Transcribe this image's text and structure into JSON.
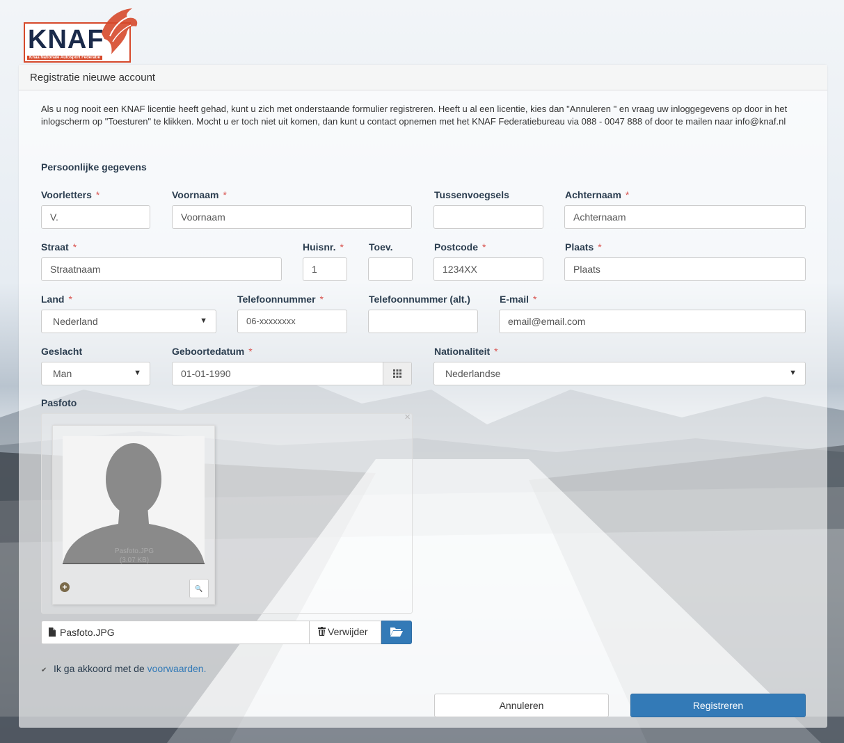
{
  "logo": {
    "text": "KNAF",
    "subtitle": "Knaa Nationale Autosport Federatie"
  },
  "panel": {
    "title": "Registratie nieuwe account",
    "intro": "Als u nog nooit een KNAF licentie heeft gehad, kunt u zich met onderstaande formulier registreren. Heeft u al een licentie, kies dan \"Annuleren \" en vraag uw inloggegevens op door in het inlogscherm op \"Toesturen\" te klikken. Mocht u er toch niet uit komen, dan kunt u contact opnemen met het KNAF Federatiebureau via 088 - 0047 888 of door te mailen naar info@knaf.nl",
    "section_title": "Persoonlijke gegevens"
  },
  "form": {
    "required_mark": "*",
    "voorletters": {
      "label": "Voorletters",
      "value": "V."
    },
    "voornaam": {
      "label": "Voornaam",
      "value": "Voornaam"
    },
    "tussenvoegsels": {
      "label": "Tussenvoegsels",
      "value": ""
    },
    "achternaam": {
      "label": "Achternaam",
      "value": "Achternaam"
    },
    "straat": {
      "label": "Straat",
      "value": "Straatnaam"
    },
    "huisnr": {
      "label": "Huisnr.",
      "value": "1"
    },
    "toev": {
      "label": "Toev.",
      "value": ""
    },
    "postcode": {
      "label": "Postcode",
      "value": "1234XX"
    },
    "plaats": {
      "label": "Plaats",
      "value": "Plaats"
    },
    "land": {
      "label": "Land",
      "value": "Nederland"
    },
    "telefoon": {
      "label": "Telefoonnummer",
      "value": "06-xxxxxxxx"
    },
    "telefoon_alt": {
      "label": "Telefoonnummer (alt.)",
      "value": ""
    },
    "email": {
      "label": "E-mail",
      "value": "email@email.com"
    },
    "geslacht": {
      "label": "Geslacht",
      "value": "Man"
    },
    "geboortedatum": {
      "label": "Geboortedatum",
      "value": "01-01-1990"
    },
    "nationaliteit": {
      "label": "Nationaliteit",
      "value": "Nederlandse"
    },
    "pasfoto": {
      "label": "Pasfoto",
      "thumb_caption": "Pasfoto.JPG",
      "thumb_size": "(3.07 KB)",
      "file_name": "Pasfoto.JPG",
      "remove_label": "Verwijder",
      "close_glyph": "×"
    },
    "agree": {
      "text": "Ik ga akkoord met de ",
      "link": "voorwaarden",
      "suffix": "."
    }
  },
  "buttons": {
    "cancel": "Annuleren",
    "register": "Registreren"
  },
  "colors": {
    "primary": "#337ab7",
    "required": "#d9534f",
    "label": "#2c3e50",
    "logo_accent": "#d6492b"
  }
}
